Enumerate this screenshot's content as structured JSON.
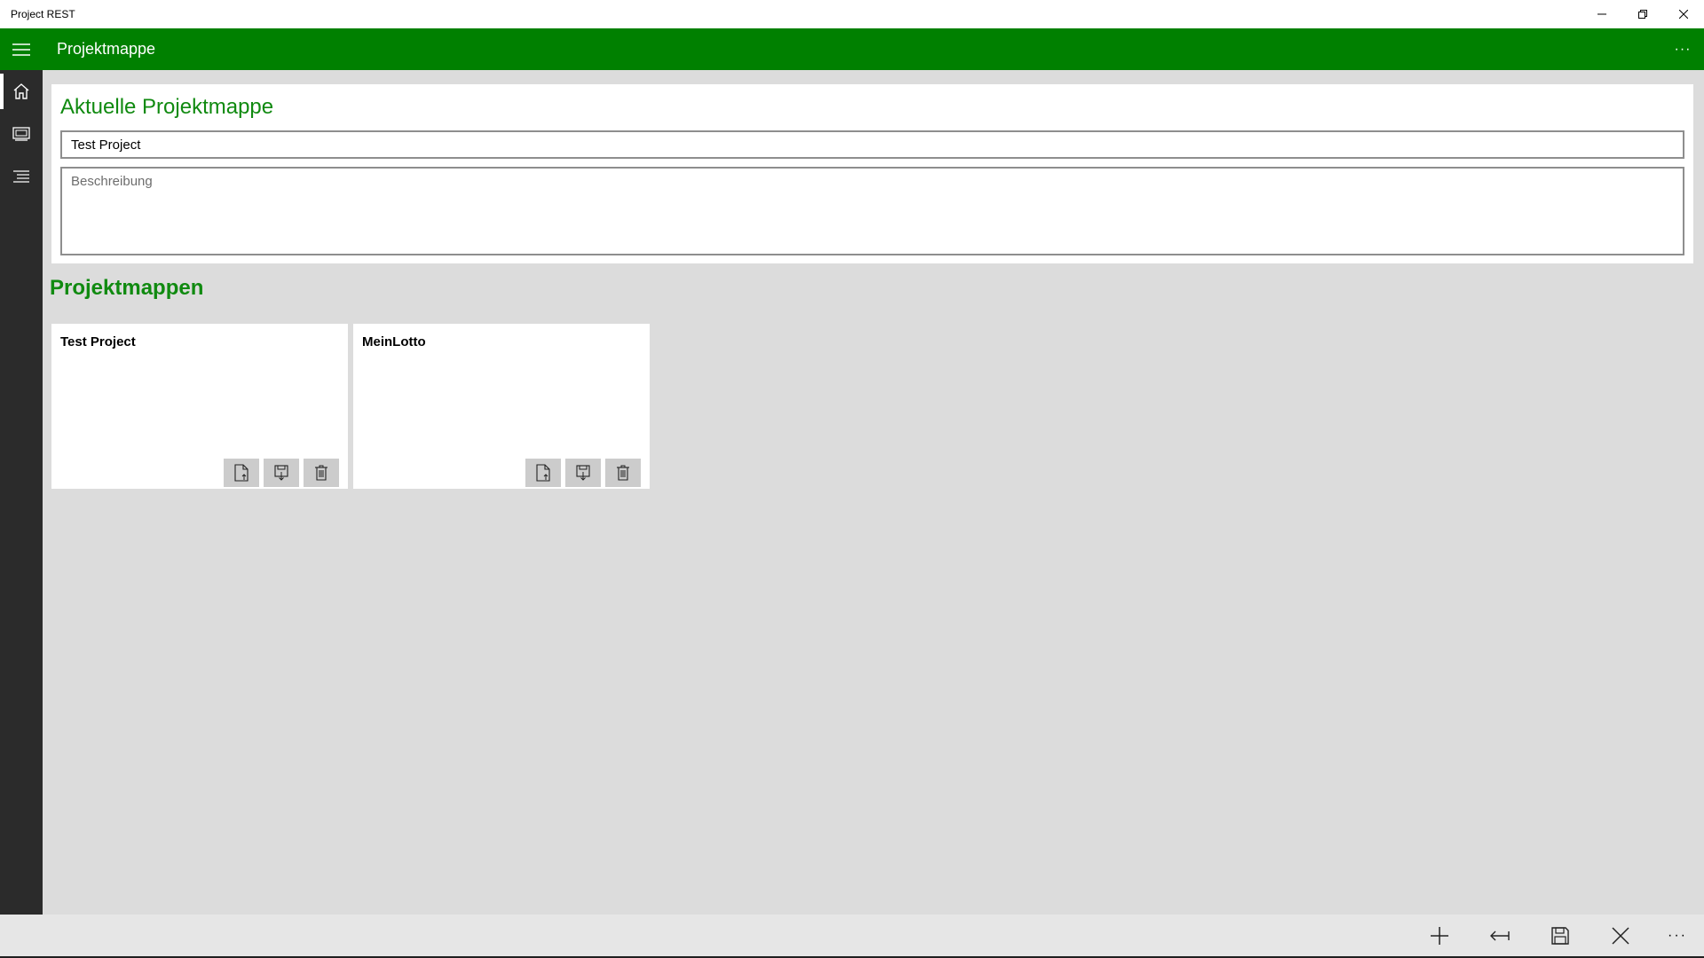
{
  "window": {
    "title": "Project REST"
  },
  "appbar": {
    "title": "Projektmappe",
    "more": "···"
  },
  "nav": {
    "items": [
      {
        "icon": "home-icon",
        "active": true
      },
      {
        "icon": "slideshow-icon",
        "active": false
      },
      {
        "icon": "list-icon",
        "active": false
      }
    ]
  },
  "current": {
    "heading": "Aktuelle Projektmappe",
    "name_value": "Test Project",
    "description_placeholder": "Beschreibung"
  },
  "list": {
    "heading": "Projektmappen",
    "cards": [
      {
        "title": "Test Project"
      },
      {
        "title": "MeinLotto"
      }
    ]
  },
  "cmdbar": {
    "more": "···"
  },
  "colors": {
    "accent": "#008000",
    "heading": "#108a10",
    "rail": "#2b2b2b"
  }
}
